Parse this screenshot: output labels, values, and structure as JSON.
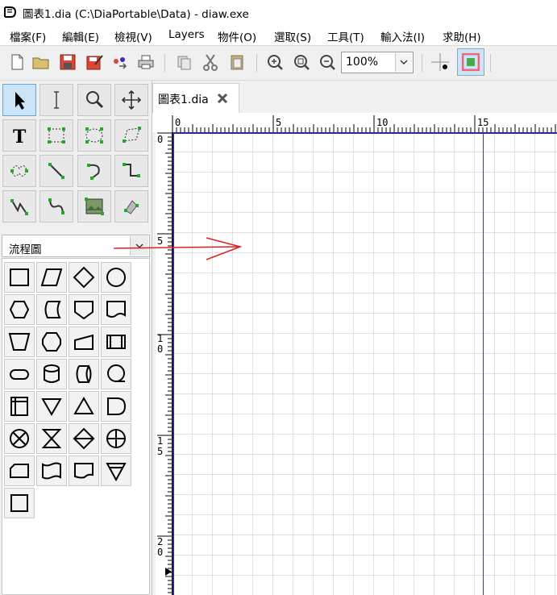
{
  "window": {
    "title": "圖表1.dia (C:\\DiaPortable\\Data) - diaw.exe"
  },
  "menu": [
    {
      "label": "檔案(F)"
    },
    {
      "label": "編輯(E)"
    },
    {
      "label": "檢視(V)"
    },
    {
      "label": "Layers"
    },
    {
      "label": "物件(O)"
    },
    {
      "label": "選取(S)"
    },
    {
      "label": "工具(T)"
    },
    {
      "label": "輸入法(I)"
    },
    {
      "label": "求助(H)"
    }
  ],
  "toolbar": {
    "zoom_value": "100%"
  },
  "sheet": {
    "selected": "流程圖"
  },
  "tab": {
    "label": "圖表1.dia"
  },
  "ruler": {
    "h_labels": [
      "0",
      "5",
      "10",
      "15"
    ],
    "v_labels": [
      "0",
      "5",
      "10",
      "15",
      "20"
    ]
  },
  "icons": {
    "tools": [
      "pointer-icon",
      "text-cursor-icon",
      "magnifier-icon",
      "move-icon",
      "text-icon",
      "box-icon",
      "ellipse-icon",
      "polygon-icon",
      "beziergon-icon",
      "line-icon",
      "arc-icon",
      "zigzag-line-icon",
      "polyline-icon",
      "bezier-line-icon",
      "image-icon",
      "outline-icon"
    ],
    "shapes": [
      "process-shape",
      "data-shape",
      "decision-shape",
      "connector-shape",
      "preparation-shape",
      "stored-data-shape",
      "offpage-shape",
      "document-shape",
      "manual-operation-shape",
      "hexagon-shape",
      "manual-input-shape",
      "predefined-process-shape",
      "terminal-shape",
      "magnetic-disk-shape",
      "direct-storage-shape",
      "sequential-storage-shape",
      "internal-storage-shape",
      "merge-shape",
      "extract-shape",
      "delay-shape",
      "summing-junction-shape",
      "collate-shape",
      "sort-shape",
      "or-shape",
      "card-shape",
      "punched-tape-shape",
      "display-shape",
      "merge-storage-shape",
      "annotation-shape"
    ]
  },
  "colors": {
    "annotation_arrow": "#e02020",
    "page_border": "#2a2a8a",
    "selected_tool": "#cce4f7"
  }
}
